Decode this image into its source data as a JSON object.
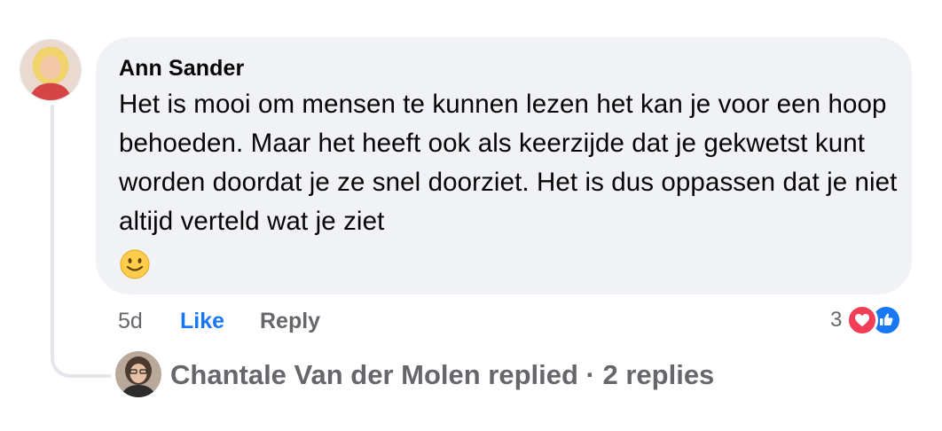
{
  "comment": {
    "author": "Ann Sander",
    "text": "Het is mooi om mensen te kunnen lezen het kan je voor een hoop behoeden. Maar het heeft ook als keerzijde dat je gekwetst kunt worden doordat je ze snel doorziet. Het is dus oppassen dat je niet altijd verteld wat je ziet",
    "emoji": "slightly-smiling-face-icon",
    "avatar": "profile-photo-avatar"
  },
  "actions": {
    "time": "5d",
    "like_label": "Like",
    "reply_label": "Reply"
  },
  "reactions": {
    "count": "3",
    "icons": [
      "love-reaction-icon",
      "like-reaction-icon"
    ]
  },
  "replies": {
    "summary": "Chantale Van der Molen replied · 2 replies",
    "avatar": "profile-photo-avatar"
  },
  "colors": {
    "bubble": "#f0f2f5",
    "text": "#050505",
    "secondary": "#65676b",
    "like_blue": "#1877f2",
    "love_red": "#f33e58",
    "thread_line": "#e4e6eb"
  }
}
